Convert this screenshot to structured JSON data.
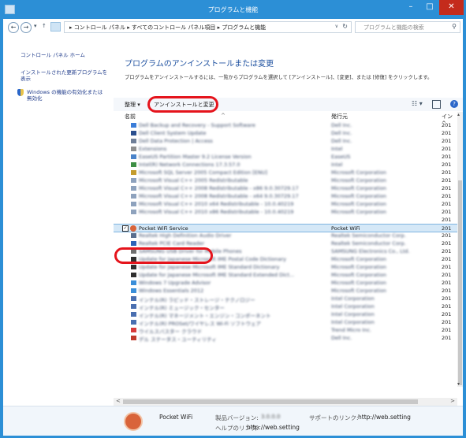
{
  "window": {
    "title": "プログラムと機能",
    "min_glyph": "–",
    "max_glyph": "□",
    "close_glyph": "✕"
  },
  "address": {
    "back_glyph": "←",
    "forward_glyph": "→",
    "history_glyph": "▾",
    "up_glyph": "↑",
    "breadcrumb": "▸ コントロール パネル ▸ すべてのコントロール パネル項目 ▸ プログラムと機能",
    "dropdown_glyph": "∨",
    "refresh_glyph": "↻",
    "search_placeholder": "プログラムと機能の検索",
    "search_glyph": "⚲"
  },
  "sidebar": {
    "home_link": "コントロール パネル ホーム",
    "updates_link_line1": "インストールされた更新プログラムを",
    "updates_link_line2": "表示",
    "features_link_line1": "Windows の機能の有効化または",
    "features_link_line2": "無効化"
  },
  "main": {
    "heading": "プログラムのアンインストールまたは変更",
    "description": "プログラムをアンインストールするには、一覧からプログラムを選択して [アンインストール]、[変更]、または [修復] をクリックします。"
  },
  "toolbar": {
    "organize": "整理 ▾",
    "uninstall": "アンインストールと変更",
    "view_glyph": "☷ ▾",
    "help_glyph": "?"
  },
  "columns": {
    "name": "名前",
    "sort_glyph": "^",
    "publisher": "発行元",
    "installed": "イン ^"
  },
  "programs": [
    {
      "name": "Dell Backup and Recovery - Support Software",
      "publisher": "Dell Inc.",
      "date": "201",
      "color": "#3b7dd8"
    },
    {
      "name": "Dell Client System Update",
      "publisher": "Dell Inc.",
      "date": "201",
      "color": "#2a4f8f"
    },
    {
      "name": "Dell Data Protection | Access",
      "publisher": "Dell Inc.",
      "date": "201",
      "color": "#6f7f98"
    },
    {
      "name": "Extensions",
      "publisher": "Intel",
      "date": "201",
      "color": "#8f8f8f"
    },
    {
      "name": "EaseUS Partition Master 9.2 License Version",
      "publisher": "EaseUS",
      "date": "201",
      "color": "#4a83c9"
    },
    {
      "name": "Intel(R) Network Connections 17.3.57.0",
      "publisher": "Intel",
      "date": "201",
      "color": "#3d8f45"
    },
    {
      "name": "Microsoft SQL Server 2005 Compact Edition [ENU]",
      "publisher": "Microsoft Corporation",
      "date": "201",
      "color": "#c49c2e"
    },
    {
      "name": "Microsoft Visual C++ 2005 Redistributable",
      "publisher": "Microsoft Corporation",
      "date": "201",
      "color": "#8ea2bd"
    },
    {
      "name": "Microsoft Visual C++ 2008 Redistributable - x86 9.0.30729.17",
      "publisher": "Microsoft Corporation",
      "date": "201",
      "color": "#8ea2bd"
    },
    {
      "name": "Microsoft Visual C++ 2008 Redistributable - x64 9.0.30729.17",
      "publisher": "Microsoft Corporation",
      "date": "201",
      "color": "#8ea2bd"
    },
    {
      "name": "Microsoft Visual C++ 2010 x64 Redistributable - 10.0.40219",
      "publisher": "Microsoft Corporation",
      "date": "201",
      "color": "#8ea2bd"
    },
    {
      "name": "Microsoft Visual C++ 2010 x86 Redistributable - 10.0.40219",
      "publisher": "Microsoft Corporation",
      "date": "201",
      "color": "#8ea2bd"
    },
    {
      "name": "",
      "publisher": "",
      "date": "201",
      "color": "#ffffff"
    },
    {
      "name": "Pocket WiFi Service",
      "publisher": "Pocket WiFi",
      "date": "201",
      "color": "#d9643a",
      "selected": true
    },
    {
      "name": "Realtek High Definition Audio Driver",
      "publisher": "Realtek Semiconductor Corp.",
      "date": "201",
      "color": "#5a6f8f"
    },
    {
      "name": "Realtek PCIE Card Reader",
      "publisher": "Realtek Semiconductor Corp.",
      "date": "201",
      "color": "#2c63b8"
    },
    {
      "name": "SAMSUNG USB Driver for Mobile Phones",
      "publisher": "SAMSUNG Electronics Co., Ltd.",
      "date": "201",
      "color": "#6f6f6f"
    },
    {
      "name": "Update for Japanese Microsoft IME Postal Code Dictionary",
      "publisher": "Microsoft Corporation",
      "date": "201",
      "color": "#2f2f2f"
    },
    {
      "name": "Update for Japanese Microsoft IME Standard Dictionary",
      "publisher": "Microsoft Corporation",
      "date": "201",
      "color": "#2f2f2f"
    },
    {
      "name": "Update for Japanese Microsoft IME Standard Extended Dict...",
      "publisher": "Microsoft Corporation",
      "date": "201",
      "color": "#2f2f2f"
    },
    {
      "name": "Windows 7 Upgrade Advisor",
      "publisher": "Microsoft Corporation",
      "date": "201",
      "color": "#3b8fd9"
    },
    {
      "name": "Windows Essentials 2012",
      "publisher": "Microsoft Corporation",
      "date": "201",
      "color": "#3b8fd9"
    },
    {
      "name": "インテル(R) ラピッド・ストレージ・テクノロジー",
      "publisher": "Intel Corporation",
      "date": "201",
      "color": "#4a6fb0"
    },
    {
      "name": "インテル(R) ミュージック・センター",
      "publisher": "Intel Corporation",
      "date": "201",
      "color": "#4a6fb0"
    },
    {
      "name": "インテル(R) マネージメント・エンジン・コンポーネント",
      "publisher": "Intel Corporation",
      "date": "201",
      "color": "#4a6fb0"
    },
    {
      "name": "インテル(R) PROSet/ワイヤレス Wi-Fi ソフトウェア",
      "publisher": "Intel Corporation",
      "date": "201",
      "color": "#4a6fb0"
    },
    {
      "name": "ウイルスバスター クラウド",
      "publisher": "Trend Micro Inc.",
      "date": "201",
      "color": "#d83a3a"
    },
    {
      "name": "デル ステータス・ユーティリティ",
      "publisher": "Dell Inc.",
      "date": "201",
      "color": "#c0392b"
    }
  ],
  "scroll": {
    "up_glyph": "▴",
    "down_glyph": "▾",
    "left_glyph": "<",
    "right_glyph": ">"
  },
  "details": {
    "name": "Pocket WiFi",
    "version_label": "製品バージョン:",
    "version_value": "3.0.0.0",
    "support_label": "サポートのリンク:",
    "support_url": "http://web.setting",
    "help_label": "ヘルプのリンク:",
    "help_url": "http://web.setting"
  },
  "check_glyph": "✓"
}
